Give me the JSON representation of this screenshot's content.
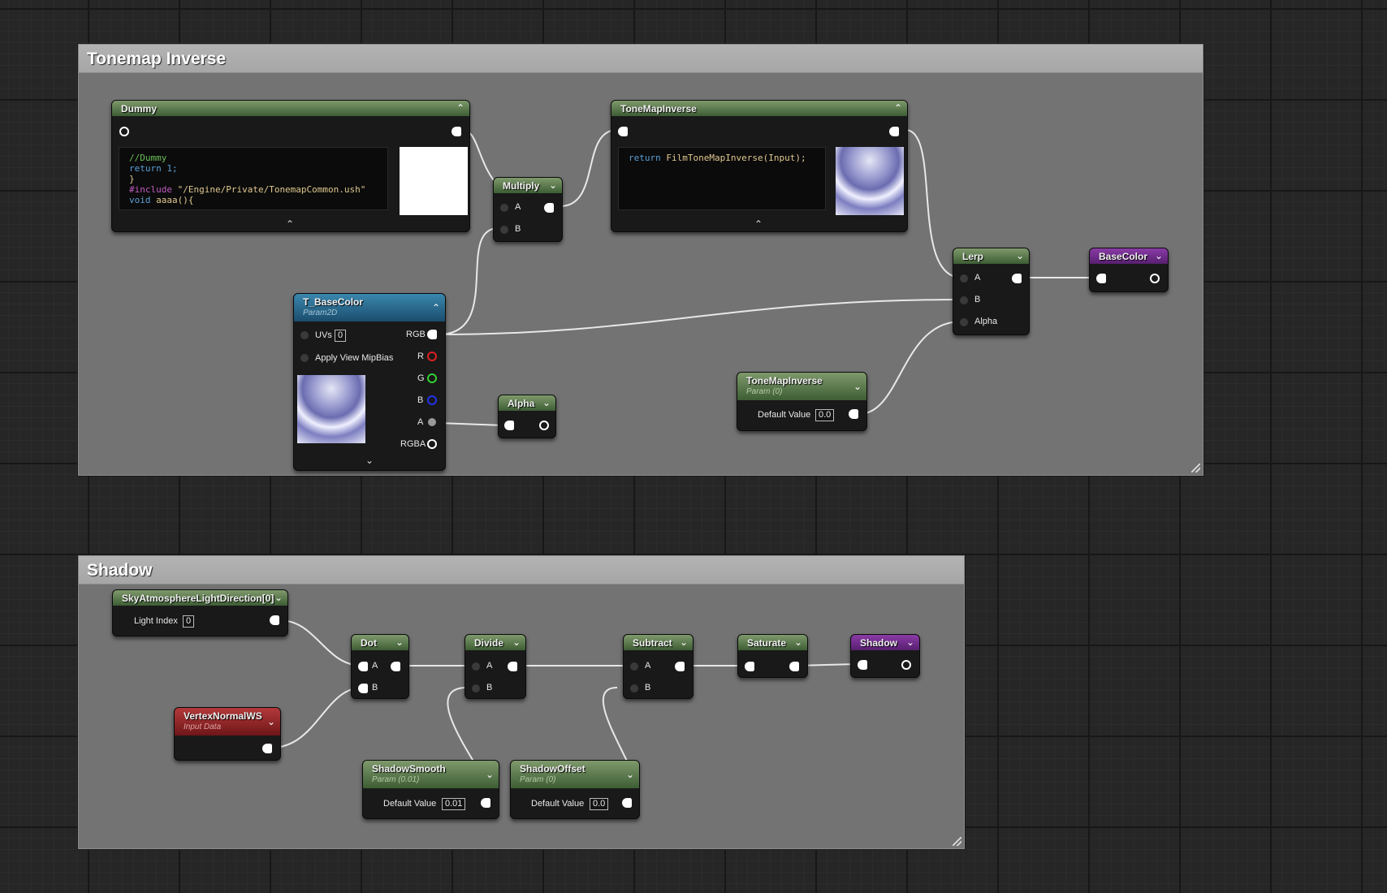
{
  "comments": {
    "tonemap": {
      "title": "Tonemap Inverse"
    },
    "shadow": {
      "title": "Shadow"
    }
  },
  "nodes": {
    "dummy": {
      "title": "Dummy",
      "code": {
        "line1": "//Dummy",
        "line2": "return 1;",
        "line3": "}",
        "line4_kw": "#include",
        "line4_str": "\"/Engine/Private/TonemapCommon.ush\"",
        "line5_kw": "void",
        "line5_rest": "aaaa(){"
      }
    },
    "multiply": {
      "title": "Multiply",
      "in_a": "A",
      "in_b": "B"
    },
    "tonemap_custom": {
      "title": "ToneMapInverse",
      "code_kw": "return",
      "code_rest": "FilmToneMapInverse(Input);"
    },
    "lerp": {
      "title": "Lerp",
      "in_a": "A",
      "in_b": "B",
      "in_alpha": "Alpha"
    },
    "basecolor": {
      "title": "BaseColor"
    },
    "tbasecolor": {
      "title": "T_BaseColor",
      "subtitle": "Param2D",
      "uvs_label": "UVs",
      "uvs_value": "0",
      "mip_label": "Apply View MipBias",
      "out_rgb": "RGB",
      "out_r": "R",
      "out_g": "G",
      "out_b": "B",
      "out_a": "A",
      "out_rgba": "RGBA"
    },
    "alpha": {
      "title": "Alpha"
    },
    "tonemap_param": {
      "title": "ToneMapInverse",
      "subtitle": "Param (0)",
      "default_label": "Default Value",
      "default_value": "0.0"
    },
    "skyatmo": {
      "title": "SkyAtmosphereLightDirection[0]",
      "light_label": "Light Index",
      "light_value": "0"
    },
    "vertexnormal": {
      "title": "VertexNormalWS",
      "subtitle": "Input Data"
    },
    "dot": {
      "title": "Dot",
      "in_a": "A",
      "in_b": "B"
    },
    "divide": {
      "title": "Divide",
      "in_a": "A",
      "in_b": "B"
    },
    "subtract": {
      "title": "Subtract",
      "in_a": "A",
      "in_b": "B"
    },
    "saturate": {
      "title": "Saturate"
    },
    "shadow_out": {
      "title": "Shadow"
    },
    "shadowsmooth": {
      "title": "ShadowSmooth",
      "subtitle": "Param (0.01)",
      "default_label": "Default Value",
      "default_value": "0.01"
    },
    "shadowoffset": {
      "title": "ShadowOffset",
      "subtitle": "Param (0)",
      "default_label": "Default Value",
      "default_value": "0.0"
    }
  },
  "colors": {
    "code_comment": "#6cbf5a",
    "code_keyword": "#5a9fd6",
    "code_string": "#e0c890",
    "code_preproc": "#c05cc0",
    "header_green": "#4f6e43",
    "header_blue": "#2a6d93",
    "header_purple": "#6e2a8a",
    "header_red": "#8f2224"
  },
  "icons": {
    "collapse": "chevron-up-icon",
    "dropdown": "chevron-down-icon"
  }
}
